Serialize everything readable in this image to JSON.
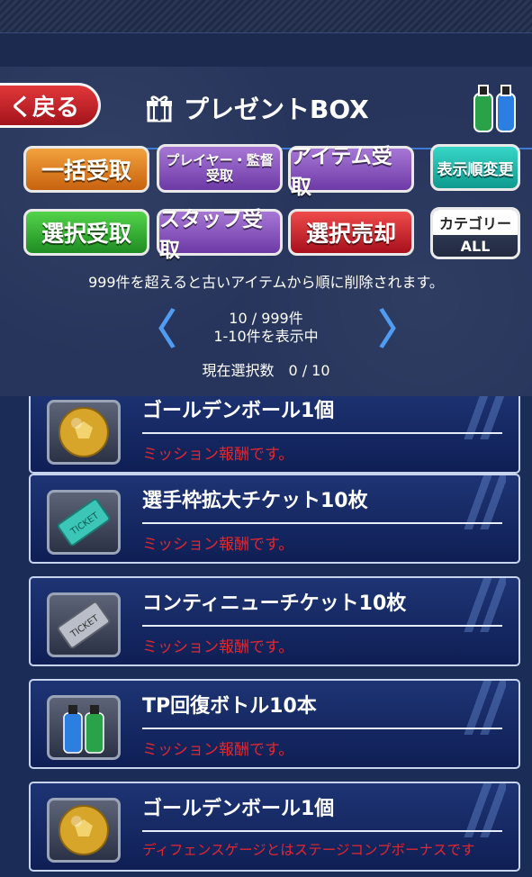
{
  "header": {
    "back_label": "く戻る",
    "title": "プレゼントBOX"
  },
  "buttons": {
    "bulk_receive": "一括受取",
    "player_manager_receive_line1": "プレイヤー・監督",
    "player_manager_receive_line2": "受取",
    "item_receive": "アイテム受取",
    "display_order": "表示順変更",
    "select_receive": "選択受取",
    "staff_receive": "スタッフ受取",
    "select_sell": "選択売却",
    "category_label": "カテゴリー",
    "category_value": "ALL"
  },
  "info": {
    "notice": "999件を超えると古いアイテムから順に削除されます。",
    "count": "10 / 999件",
    "range": "1-10件を表示中",
    "selection": "現在選択数　0 / 10"
  },
  "items": [
    {
      "name": "ゴールデンボール1個",
      "desc": "ミッション報酬です。",
      "icon": "golden-ball-icon"
    },
    {
      "name": "選手枠拡大チケット10枚",
      "desc": "ミッション報酬です。",
      "icon": "teal-ticket-icon"
    },
    {
      "name": "コンティニューチケット10枚",
      "desc": "ミッション報酬です。",
      "icon": "silver-ticket-icon"
    },
    {
      "name": "TP回復ボトル10本",
      "desc": "ミッション報酬です。",
      "icon": "tp-bottle-icon"
    },
    {
      "name": "ゴールデンボール1個",
      "desc": "ディフェンスゲージとはステージコンプボーナスです",
      "icon": "golden-ball-icon"
    }
  ],
  "colors": {
    "accent_blue": "#4f9cf2",
    "reward_text_red": "#e4262e"
  }
}
